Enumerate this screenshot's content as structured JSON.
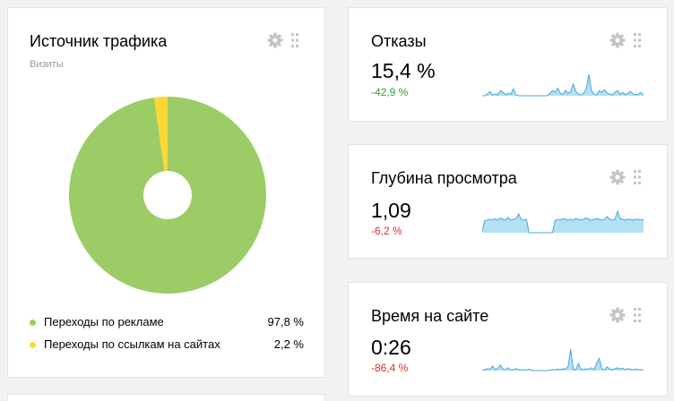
{
  "traffic_source": {
    "title": "Источник трафика",
    "subtitle": "Визиты",
    "colors": {
      "ads": "#9ccc65",
      "links": "#fdd835"
    },
    "legend": [
      {
        "label": "Переходы по рекламе",
        "value": "97,8 %"
      },
      {
        "label": "Переходы по ссылкам на сайтах",
        "value": "2,2 %"
      }
    ],
    "chart_data": {
      "type": "pie",
      "categories": [
        "Переходы по рекламе",
        "Переходы по ссылкам на сайтах"
      ],
      "values": [
        97.8,
        2.2
      ],
      "title": "Источник трафика",
      "subtitle": "Визиты",
      "legend": "bottom"
    }
  },
  "metrics": [
    {
      "title": "Отказы",
      "value": "15,4 %",
      "change": "-42,9 %",
      "trend": "positive",
      "sparkline": [
        0,
        0,
        0.2,
        0.5,
        0.1,
        0.2,
        0.1,
        0.6,
        0.4,
        0.1,
        0.3,
        0.2,
        0.8,
        0.1,
        0,
        0,
        0,
        0,
        0,
        0,
        0,
        0,
        0,
        0,
        0,
        0,
        0.3,
        0.6,
        0.4,
        0.9,
        0.3,
        0.2,
        0.6,
        0.3,
        0.5,
        1.4,
        0.5,
        0.2,
        0.1,
        0.3,
        0.8,
        2.5,
        0.6,
        0.2,
        0.1,
        0.6,
        0.4,
        0.7,
        0.3,
        0.2,
        0.1,
        0.4,
        0.6,
        0.2,
        0.4,
        0.1,
        0.3,
        0.5,
        0.2,
        0.1,
        0.2,
        0.4,
        0.1
      ]
    },
    {
      "title": "Глубина просмотра",
      "value": "1,09",
      "change": "-6,2 %",
      "trend": "negative",
      "sparkline": [
        0.2,
        1.8,
        1.9,
        2.0,
        1.9,
        2.1,
        1.9,
        2.2,
        2.0,
        1.9,
        2.3,
        1.9,
        2.0,
        2.1,
        2.8,
        2.0,
        1.9,
        2.0,
        0,
        0,
        0,
        0,
        0,
        0,
        0,
        0,
        0,
        0,
        1.8,
        2.0,
        1.9,
        2.1,
        2.0,
        1.9,
        2.0,
        1.9,
        2.1,
        2.0,
        1.9,
        2.0,
        2.2,
        2.0,
        1.9,
        2.0,
        2.1,
        2.0,
        1.9,
        2.0,
        2.4,
        2.0,
        1.9,
        2.0,
        3.2,
        2.1,
        2.0,
        1.9,
        2.0,
        2.0,
        1.9,
        2.0,
        2.0,
        1.9,
        2.0
      ]
    },
    {
      "title": "Время на сайте",
      "value": "0:26",
      "change": "-86,4 %",
      "trend": "negative",
      "sparkline": [
        0.1,
        0.2,
        0.4,
        0.3,
        1.0,
        0.2,
        0.5,
        1.2,
        0.3,
        0.2,
        0.6,
        0.1,
        0.2,
        0.4,
        0.2,
        0.1,
        0.2,
        0.1,
        0.3,
        0,
        0,
        0,
        0,
        0,
        0,
        0,
        0.1,
        0.2,
        0.1,
        0.3,
        0.2,
        0.4,
        0.3,
        0.8,
        4.6,
        0.3,
        0.2,
        1.5,
        0.3,
        0.2,
        0.4,
        0.3,
        0.6,
        0.2,
        1.6,
        2.6,
        0.3,
        0.2,
        0.8,
        0.3,
        0.2,
        0.4,
        0.6,
        0.3,
        0.5,
        0.2,
        0.4,
        0.3,
        0.2,
        0.3,
        0.2,
        0.2,
        0.1
      ]
    }
  ]
}
